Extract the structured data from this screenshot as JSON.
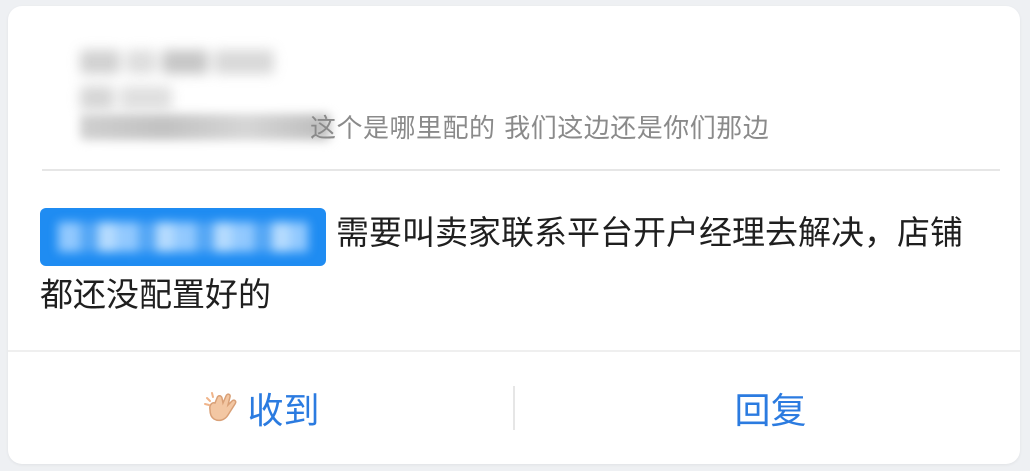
{
  "quote": {
    "author_redacted": "",
    "text": "这个是哪里配的  我们这边还是你们那边"
  },
  "message": {
    "mention_redacted": "",
    "text": "需要叫卖家联系平台开户经理去解决，店铺都还没配置好的"
  },
  "actions": {
    "received": {
      "label": "收到",
      "icon": "clapping-hand-icon"
    },
    "reply": {
      "label": "回复"
    }
  },
  "colors": {
    "accent": "#2b7be0",
    "mention_bg": "#1f8cf2",
    "quote_text": "#8a8a8a"
  }
}
